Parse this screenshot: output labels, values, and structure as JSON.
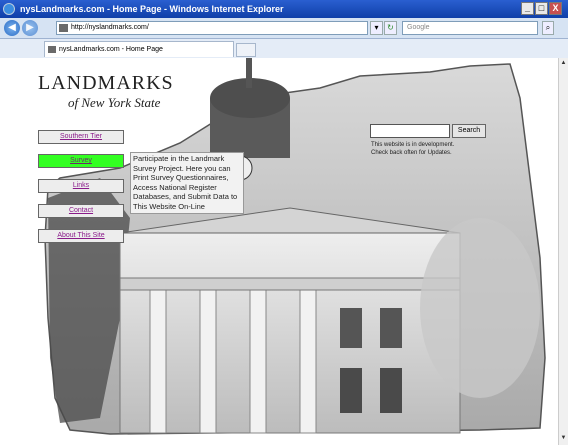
{
  "window": {
    "title": "nysLandmarks.com - Home Page - Windows Internet Explorer",
    "minimize": "_",
    "maximize": "□",
    "close": "X"
  },
  "addressbar": {
    "url": "http://nyslandmarks.com/",
    "search_placeholder": "Google"
  },
  "tabs": [
    {
      "label": "nysLandmarks.com - Home Page"
    }
  ],
  "site": {
    "logo_title": "LANDMARKS",
    "logo_subtitle": "of New York State",
    "nav": [
      {
        "label": "Southern Tier",
        "active": false
      },
      {
        "label": "Survey",
        "active": true
      },
      {
        "label": "Links",
        "active": false
      },
      {
        "label": "Contact",
        "active": false
      },
      {
        "label": "About This Site",
        "active": false
      }
    ],
    "tooltip": "Participate in the Landmark Survey Project. Here you can Print Survey Questionnaires, Access National Register Databases, and Submit Data to This Website On-Line",
    "search": {
      "value": "",
      "button": "Search"
    },
    "note_line1": "This website is in development.",
    "note_line2": "Check back often for Updates."
  },
  "colors": {
    "titlebar": "#0f3fa8",
    "active_nav": "#33ff22",
    "link": "#8a1a8a"
  },
  "icons": [
    "ie-icon",
    "back-icon",
    "forward-icon",
    "page-icon",
    "refresh-icon",
    "stop-icon",
    "search-icon",
    "favorites-star-icon",
    "add-favorites-icon"
  ]
}
